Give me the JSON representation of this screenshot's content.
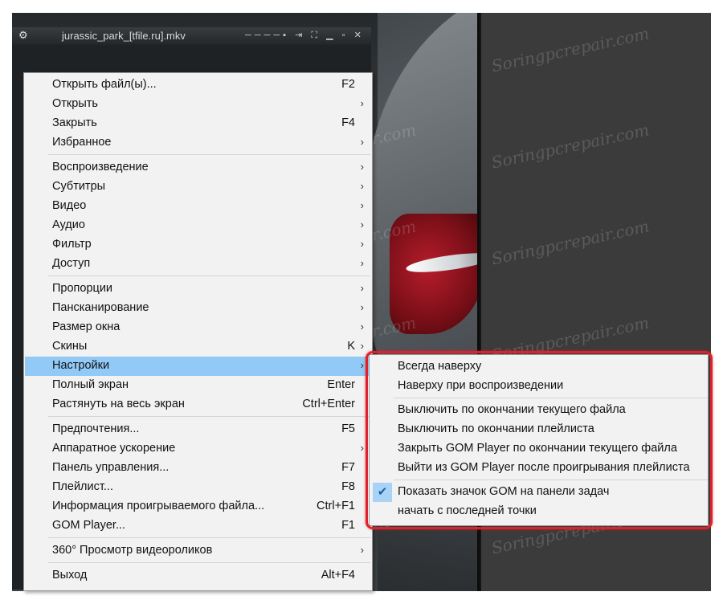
{
  "window": {
    "title": "jurassic_park_[tfile.ru].mkv"
  },
  "watermark": {
    "text": "Soringpcrepair.com"
  },
  "main_menu": {
    "items": [
      {
        "label": "Открыть файл(ы)...",
        "shortcut": "F2",
        "submenu": false
      },
      {
        "label": "Открыть",
        "shortcut": "",
        "submenu": true
      },
      {
        "label": "Закрыть",
        "shortcut": "F4",
        "submenu": false
      },
      {
        "label": "Избранное",
        "shortcut": "",
        "submenu": true
      },
      {
        "label": "Воспроизведение",
        "shortcut": "",
        "submenu": true
      },
      {
        "label": "Субтитры",
        "shortcut": "",
        "submenu": true
      },
      {
        "label": "Видео",
        "shortcut": "",
        "submenu": true
      },
      {
        "label": "Аудио",
        "shortcut": "",
        "submenu": true
      },
      {
        "label": "Фильтр",
        "shortcut": "",
        "submenu": true
      },
      {
        "label": "Доступ",
        "shortcut": "",
        "submenu": true
      },
      {
        "label": "Пропорции",
        "shortcut": "",
        "submenu": true
      },
      {
        "label": "Пансканирование",
        "shortcut": "",
        "submenu": true
      },
      {
        "label": "Размер окна",
        "shortcut": "",
        "submenu": true
      },
      {
        "label": "Скины",
        "shortcut": "K",
        "submenu": true
      },
      {
        "label": "Настройки",
        "shortcut": "",
        "submenu": true,
        "highlighted": true
      },
      {
        "label": "Полный экран",
        "shortcut": "Enter",
        "submenu": false
      },
      {
        "label": "Растянуть на весь экран",
        "shortcut": "Ctrl+Enter",
        "submenu": false
      },
      {
        "label": "Предпочтения...",
        "shortcut": "F5",
        "submenu": false
      },
      {
        "label": "Аппаратное ускорение",
        "shortcut": "",
        "submenu": true
      },
      {
        "label": "Панель управления...",
        "shortcut": "F7",
        "submenu": false
      },
      {
        "label": "Плейлист...",
        "shortcut": "F8",
        "submenu": false
      },
      {
        "label": "Информация проигрываемого файла...",
        "shortcut": "Ctrl+F1",
        "submenu": false
      },
      {
        "label": "GOM Player...",
        "shortcut": "F1",
        "submenu": false
      },
      {
        "label": "360° Просмотр видеороликов",
        "shortcut": "",
        "submenu": true
      },
      {
        "label": "Выход",
        "shortcut": "Alt+F4",
        "submenu": false
      }
    ]
  },
  "settings_submenu": {
    "items": [
      {
        "label": "Всегда наверху",
        "checked": false
      },
      {
        "label": "Наверху при воспроизведении",
        "checked": false
      },
      {
        "label": "Выключить по окончании текущего файла",
        "checked": false
      },
      {
        "label": "Выключить по окончании плейлиста",
        "checked": false
      },
      {
        "label": "Закрыть GOM Player по окончании текущего файла",
        "checked": false
      },
      {
        "label": "Выйти из GOM Player после проигрывания плейлиста",
        "checked": false
      },
      {
        "label": "Показать значок GOM на панели задач",
        "checked": true
      },
      {
        "label": "начать с последней точки",
        "checked": false
      }
    ]
  },
  "colors": {
    "highlight": "#91c9f7",
    "annotation_frame": "#e0202a"
  }
}
